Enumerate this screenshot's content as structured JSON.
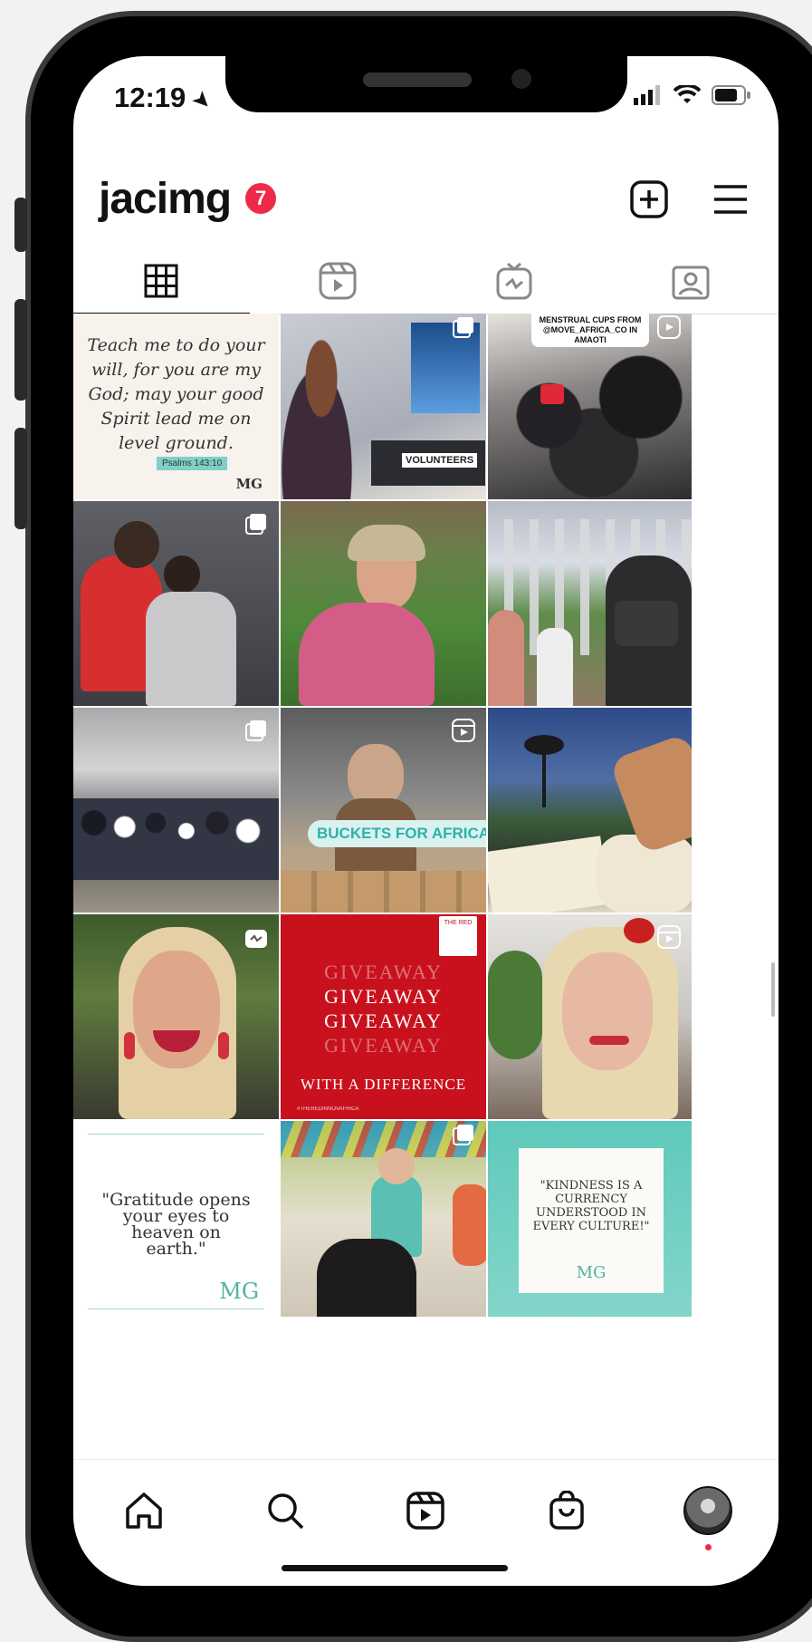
{
  "status": {
    "time": "12:19"
  },
  "profile": {
    "username": "jacimg",
    "notifications": "7"
  },
  "tabs": [
    "grid-icon",
    "reels-icon",
    "igtv-icon",
    "tagged-icon"
  ],
  "posts": {
    "p1": {
      "quote": "Teach me to do your will, for you are my God; may your good Spirit lead me on level ground.",
      "ref": "Psalms 143:10",
      "logo": "MG"
    },
    "p2": {
      "label": "VOLUNTEERS"
    },
    "p3": {
      "caption": "MENSTRUAL CUPS FROM @MOVE_AFRICA_CO IN AMAOTI"
    },
    "p8": {
      "caption": "BUCKETS FOR AFRICA"
    },
    "p11": {
      "lines": [
        "GIVEAWAY",
        "GIVEAWAY",
        "GIVEAWAY",
        "GIVEAWAY"
      ],
      "sub": "WITH A DIFFERENCE",
      "tag": "#THEREDINNOVAFRICA",
      "corner": "THE RED"
    },
    "p13": {
      "quote": "\"Gratitude opens your eyes to heaven on earth.\"",
      "logo": "MG"
    },
    "p15": {
      "quote": "\"KINDNESS IS A CURRENCY UNDERSTOOD IN EVERY CULTURE!\"",
      "logo": "MG"
    }
  },
  "nav": [
    "home-icon",
    "search-icon",
    "reels-icon",
    "shop-icon",
    "profile-avatar"
  ]
}
